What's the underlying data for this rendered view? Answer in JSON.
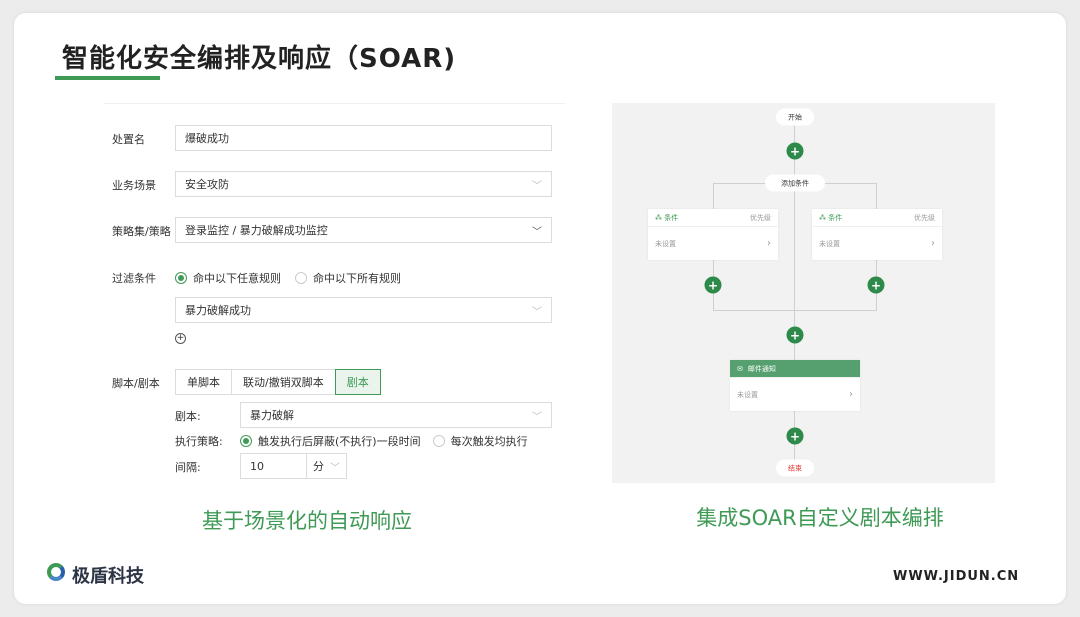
{
  "title": "智能化安全编排及响应（SOAR)",
  "form": {
    "disposal_name": {
      "label": "处置名",
      "value": "爆破成功"
    },
    "scene": {
      "label": "业务场景",
      "value": "安全攻防"
    },
    "policy": {
      "label": "策略集/策略",
      "value": "登录监控 / 暴力破解成功监控"
    },
    "filter": {
      "label": "过滤条件",
      "options": [
        "命中以下任意规则",
        "命中以下所有规则"
      ],
      "selected": 0,
      "rule": "暴力破解成功"
    },
    "script": {
      "label": "脚本/剧本",
      "tabs": [
        "单脚本",
        "联动/撤销双脚本",
        "剧本"
      ],
      "active_tab": 2,
      "playbook_label": "剧本:",
      "playbook_value": "暴力破解",
      "strategy_label": "执行策略:",
      "strategy_options": [
        "触发执行后屏蔽(不执行)一段时间",
        "每次触发均执行"
      ],
      "strategy_selected": 0,
      "interval_label": "间隔:",
      "interval_value": "10",
      "interval_unit": "分"
    }
  },
  "flow": {
    "start": "开始",
    "add_condition": "添加条件",
    "conditions": [
      {
        "title": "条件",
        "priority": "优先级",
        "status": "未设置"
      },
      {
        "title": "条件",
        "priority": "优先级",
        "status": "未设置"
      }
    ],
    "email": {
      "title": "邮件通知",
      "status": "未设置"
    },
    "end": "结束"
  },
  "captions": {
    "left": "基于场景化的自动响应",
    "right": "集成SOAR自定义剧本编排"
  },
  "footer": {
    "brand": "极盾科技",
    "url": "WWW.JIDUN.CN"
  },
  "colors": {
    "accent": "#3f9a55",
    "node_header": "#55a06e",
    "end_text": "#e53935"
  }
}
